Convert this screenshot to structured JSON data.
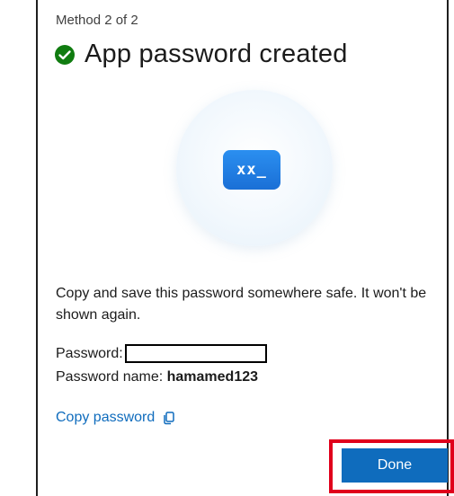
{
  "dialog": {
    "step_text": "Method 2 of 2",
    "title": "App password created",
    "key_tile_text": "xx_",
    "description": "Copy and save this password somewhere safe. It won't be shown again.",
    "password_label": "Password:",
    "password_value": "",
    "password_name_label": "Password name:",
    "password_name_value": "hamamed123",
    "copy_link_label": "Copy password",
    "done_label": "Done"
  },
  "colors": {
    "accent": "#0f6cbd",
    "success": "#107c10",
    "highlight": "#e0001b"
  },
  "icons": {
    "status": "checkmark-circle-icon",
    "hero": "password-key-icon",
    "copy": "copy-icon"
  }
}
